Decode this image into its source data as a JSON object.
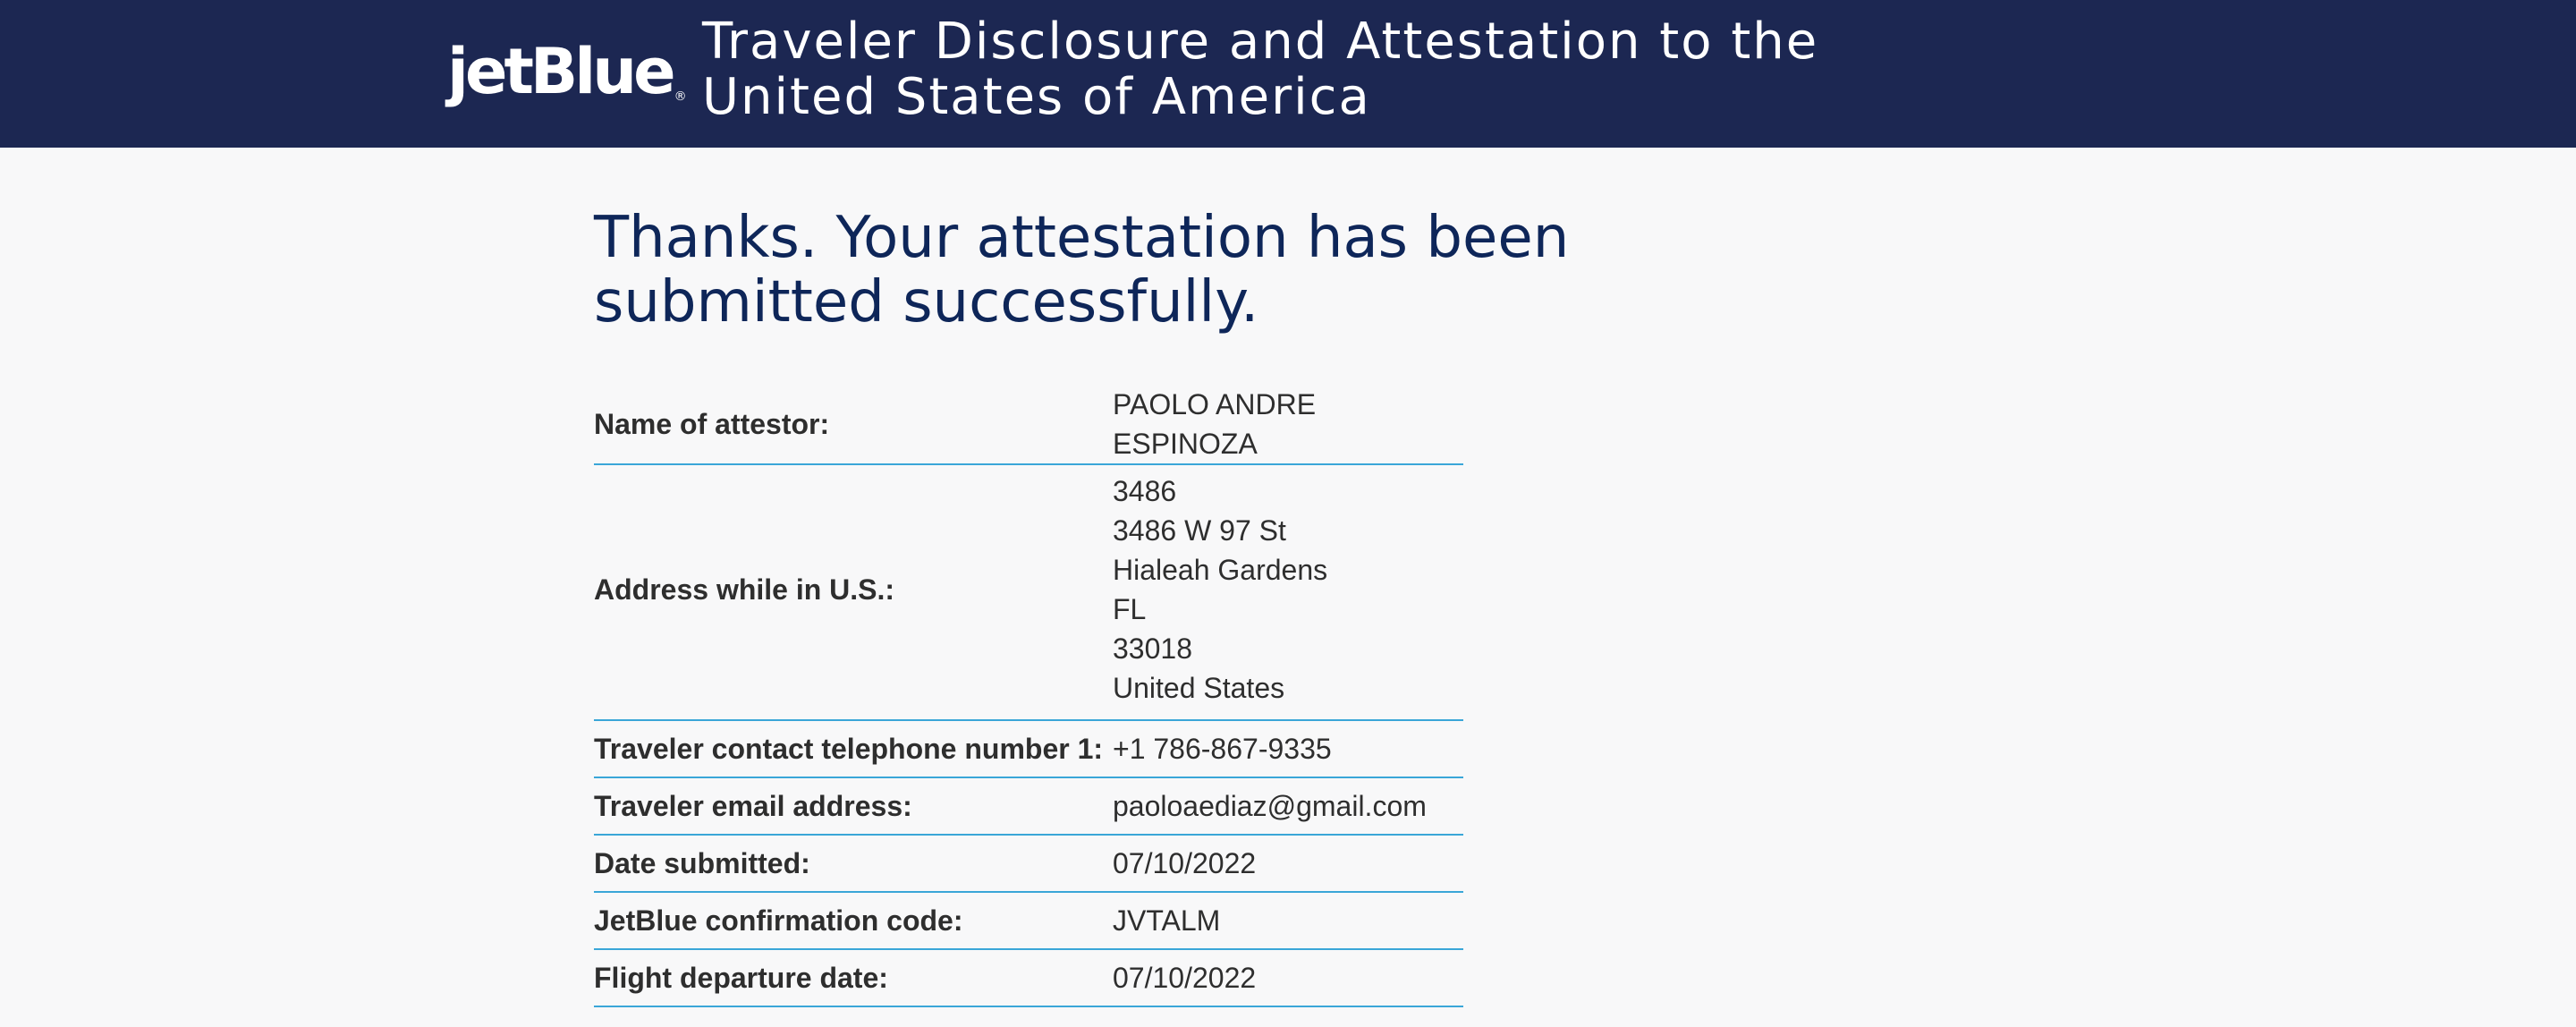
{
  "header": {
    "logo_text": "jetBlue",
    "logo_mark": "®",
    "title": "Traveler Disclosure and Attestation to the United States of America"
  },
  "main": {
    "confirmation_heading": "Thanks. Your attestation has been submitted successfully."
  },
  "details": {
    "name": {
      "label": "Name of attestor:",
      "value": "PAOLO ANDRE ESPINOZA"
    },
    "address": {
      "label": "Address while in U.S.:",
      "lines": [
        "3486",
        "3486 W 97 St",
        "Hialeah Gardens",
        "FL",
        "33018",
        "United States"
      ]
    },
    "phone": {
      "label": "Traveler contact telephone number 1:",
      "value": "+1 786-867-9335"
    },
    "email": {
      "label": "Traveler email address:",
      "value": "paoloaediaz@gmail.com"
    },
    "date_submitted": {
      "label": "Date submitted:",
      "value": "07/10/2022"
    },
    "confirmation_code": {
      "label": "JetBlue confirmation code:",
      "value": "JVTALM"
    },
    "departure_date": {
      "label": "Flight departure date:",
      "value": "07/10/2022"
    }
  },
  "colors": {
    "header_bg": "#1c2752",
    "heading_text": "#0e2659",
    "divider": "#3aa6d8",
    "page_bg": "#f8f8f9"
  }
}
